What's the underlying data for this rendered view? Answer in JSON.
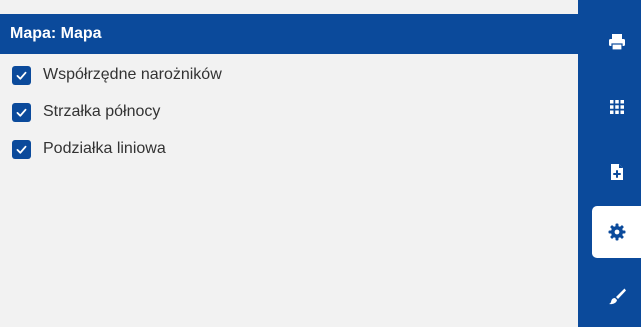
{
  "panel": {
    "title": "Mapa: Mapa",
    "options": [
      {
        "label": "Współrzędne narożników",
        "checked": true
      },
      {
        "label": "Strzałka północy",
        "checked": true
      },
      {
        "label": "Podziałka liniowa",
        "checked": true
      }
    ]
  },
  "toolbar": {
    "buttons": [
      {
        "icon": "printer-icon",
        "active": false
      },
      {
        "icon": "grid-icon",
        "active": false
      },
      {
        "icon": "file-add-icon",
        "active": false
      },
      {
        "icon": "gear-icon",
        "active": true
      },
      {
        "icon": "paintbrush-icon",
        "active": false
      }
    ]
  },
  "colors": {
    "accent": "#0b4a9b",
    "panel_bg": "#f2f2f2",
    "text": "#333333"
  }
}
